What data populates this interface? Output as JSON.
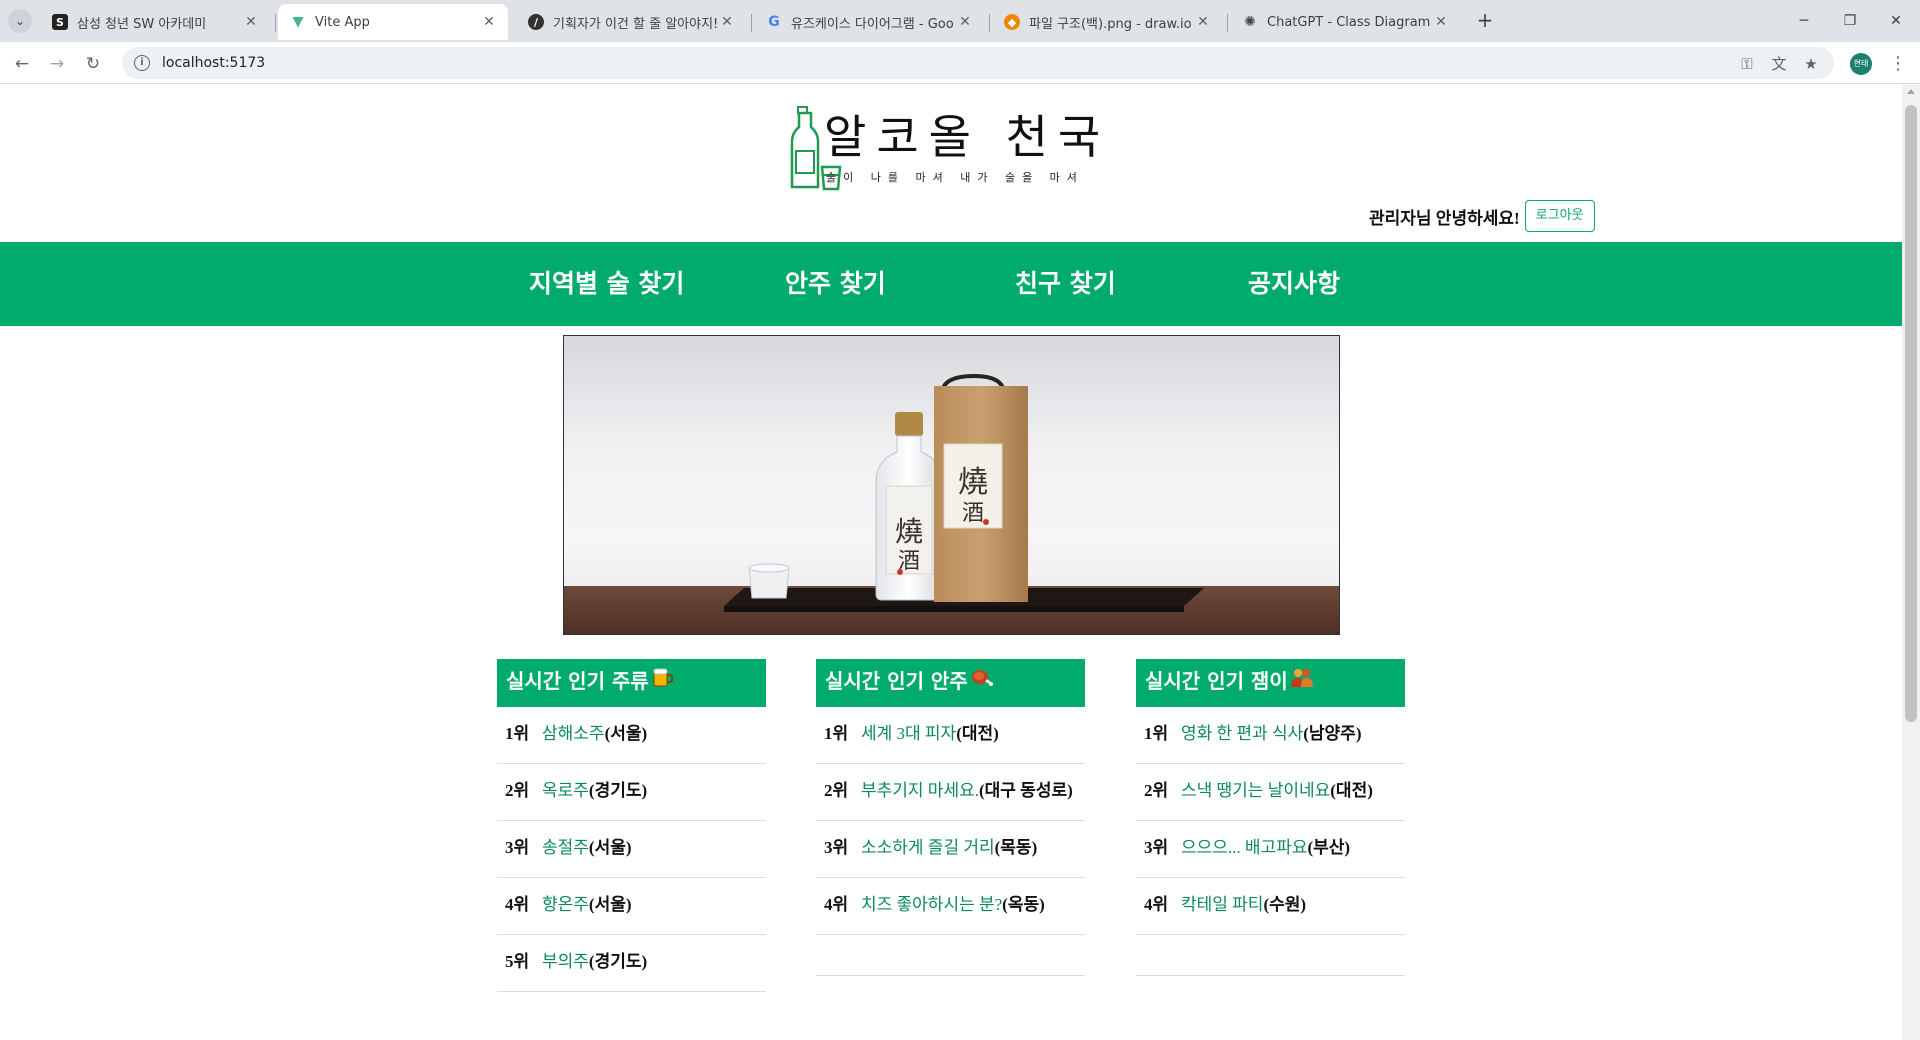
{
  "browser": {
    "tabs": [
      {
        "title": "삼성 청년 SW 아카데미",
        "favicon": "ssafy-icon",
        "active": false
      },
      {
        "title": "Vite App",
        "favicon": "vite-icon",
        "active": true
      },
      {
        "title": "기획자가 이건 할 줄 알아야지!",
        "favicon": "notion-icon",
        "active": false
      },
      {
        "title": "유즈케이스 다이어그램 - Goo",
        "favicon": "google-icon",
        "active": false
      },
      {
        "title": "파일 구조(백).png - draw.io",
        "favicon": "drawio-icon",
        "active": false
      },
      {
        "title": "ChatGPT - Class Diagram Crea",
        "favicon": "chatgpt-icon",
        "active": false
      }
    ],
    "url": "localhost:5173",
    "profile_initials": "현태",
    "window_controls": [
      "minimize-icon",
      "restore-icon",
      "close-icon"
    ]
  },
  "header": {
    "title": "알코올 천국",
    "slogan": "술이 나를 마셔 내가 술을 마셔",
    "greeting": "관리자님 안녕하세요!",
    "logout_label": "로그아웃"
  },
  "nav": {
    "items": [
      "지역별 술 찾기",
      "안주 찾기",
      "친구 찾기",
      "공지사항"
    ]
  },
  "rankings": [
    {
      "title": "실시간 인기 주류",
      "emoji_icon": "beer-mug-icon",
      "items": [
        {
          "rank": "1위",
          "name": "삼해소주",
          "location": "(서울)"
        },
        {
          "rank": "2위",
          "name": "옥로주",
          "location": "(경기도)"
        },
        {
          "rank": "3위",
          "name": "송절주",
          "location": "(서울)"
        },
        {
          "rank": "4위",
          "name": "향온주",
          "location": "(서울)"
        },
        {
          "rank": "5위",
          "name": "부의주",
          "location": "(경기도)"
        }
      ]
    },
    {
      "title": "실시간 인기 안주",
      "emoji_icon": "meat-on-bone-icon",
      "items": [
        {
          "rank": "1위",
          "name": "세계 3대 피자",
          "location": "(대전)"
        },
        {
          "rank": "2위",
          "name": "부추기지 마세요.",
          "location": "(대구 동성로)"
        },
        {
          "rank": "3위",
          "name": "소소하게 즐길 거리",
          "location": "(목동)"
        },
        {
          "rank": "4위",
          "name": "치즈 좋아하시는 분?",
          "location": "(옥동)"
        }
      ]
    },
    {
      "title": "실시간 인기 잼이",
      "emoji_icon": "people-icon",
      "items": [
        {
          "rank": "1위",
          "name": "영화 한 편과 식사",
          "location": "(남양주)"
        },
        {
          "rank": "2위",
          "name": "스낵 땡기는 날이네요",
          "location": "(대전)"
        },
        {
          "rank": "3위",
          "name": "으으으... 배고파요",
          "location": "(부산)"
        },
        {
          "rank": "4위",
          "name": "칵테일 파티",
          "location": "(수원)"
        }
      ]
    }
  ],
  "colors": {
    "brand_green": "#00ab6c",
    "link_green": "#0b8a58"
  }
}
